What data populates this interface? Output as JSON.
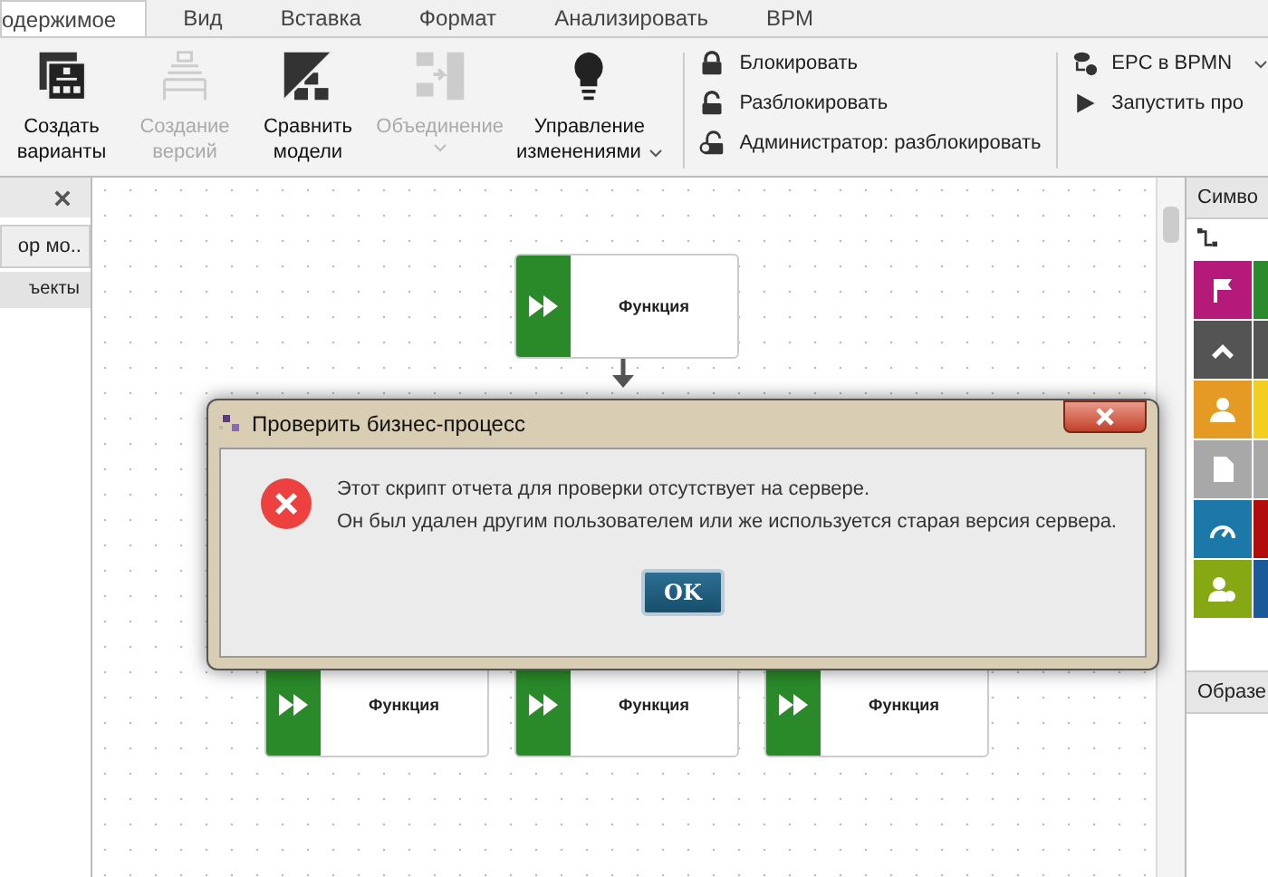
{
  "menu_tabs": [
    {
      "label": "одержимое",
      "selected": true
    },
    {
      "label": "Вид",
      "selected": false
    },
    {
      "label": "Вставка",
      "selected": false
    },
    {
      "label": "Формат",
      "selected": false
    },
    {
      "label": "Анализировать",
      "selected": false
    },
    {
      "label": "BPM",
      "selected": false
    }
  ],
  "ribbon": {
    "large_buttons": [
      {
        "kind": "variants",
        "lines": [
          "Создать",
          "варианты"
        ],
        "disabled": false,
        "dropdown": false
      },
      {
        "kind": "versions",
        "lines": [
          "Создание",
          "версий"
        ],
        "disabled": true,
        "dropdown": false
      },
      {
        "kind": "compare",
        "lines": [
          "Сравнить",
          "модели"
        ],
        "disabled": false,
        "dropdown": false
      },
      {
        "kind": "merge",
        "lines": [
          "Объединение"
        ],
        "disabled": true,
        "dropdown": true
      },
      {
        "kind": "bulb",
        "lines": [
          "Управление",
          "изменениями"
        ],
        "disabled": false,
        "dropdown": true
      }
    ],
    "lock_buttons": [
      {
        "kind": "lock",
        "label": "Блокировать"
      },
      {
        "kind": "unlock",
        "label": "Разблокировать"
      },
      {
        "kind": "admin",
        "label": "Администратор: разблокировать"
      }
    ],
    "bpm_buttons": [
      {
        "kind": "convert",
        "label": "EPC в BPMN",
        "dropdown": true
      },
      {
        "kind": "run",
        "label": "Запустить про",
        "dropdown": false
      }
    ]
  },
  "left_panel": {
    "items": [
      {
        "label": "ор мо..",
        "kind": "button"
      },
      {
        "label": "ъекты",
        "kind": "header"
      }
    ]
  },
  "canvas": {
    "nodes": [
      {
        "label": "Функция"
      },
      {
        "label": "Функция"
      },
      {
        "label": "Функция"
      },
      {
        "label": "Функция"
      }
    ]
  },
  "right_panel": {
    "title": "Симво",
    "tiles": [
      {
        "kind": "flag",
        "color": "#b5197a"
      },
      {
        "kind": "chevron",
        "color": "#545454"
      },
      {
        "kind": "person",
        "color": "#e59a24"
      },
      {
        "kind": "document",
        "color": "#a8a8a8"
      },
      {
        "kind": "gauge",
        "color": "#1b78a8"
      },
      {
        "kind": "user-gear",
        "color": "#86a812"
      }
    ],
    "tiles_column_2": [
      {
        "color": "#2b8a2b"
      },
      {
        "color": "#545454"
      },
      {
        "color": "#f2cf1e"
      },
      {
        "color": "#a8a8a8"
      },
      {
        "color": "#b30c0c"
      },
      {
        "color": "#1b5a98"
      }
    ],
    "footer": "Образе"
  },
  "dialog": {
    "title": "Проверить бизнес-процесс",
    "lines": [
      "Этот скрипт отчета для проверки отсутствует на сервере.",
      "Он был удален другим пользователем или же используется старая версия сервера."
    ],
    "button": "OK"
  }
}
